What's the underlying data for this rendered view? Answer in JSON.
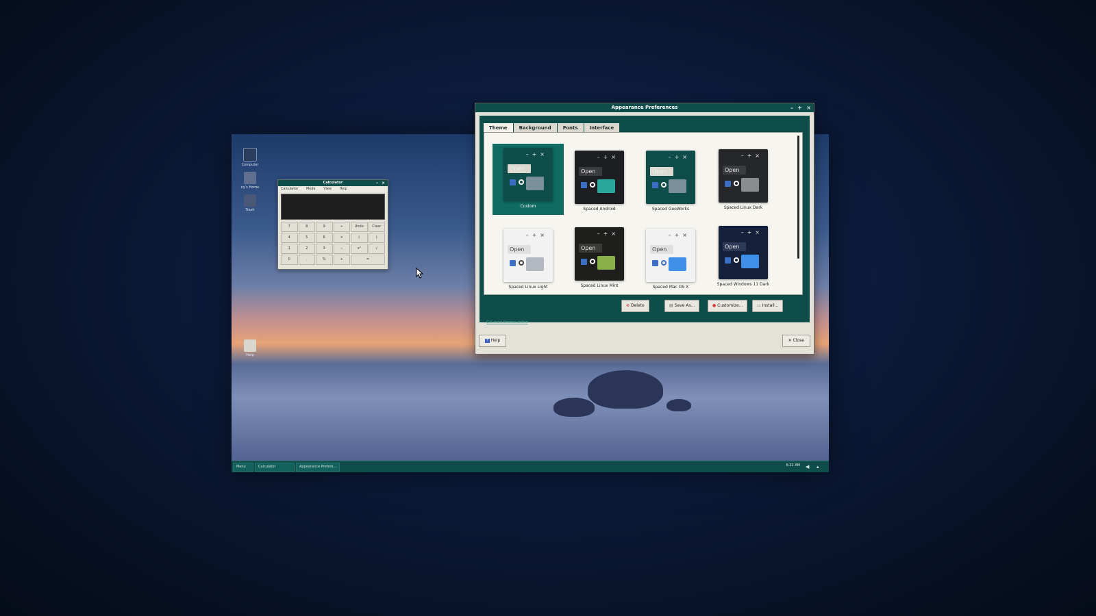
{
  "desktop": {
    "icons": [
      {
        "label": "Computer",
        "icon": "computer-icon"
      },
      {
        "label": "ny's Home",
        "icon": "home-icon"
      },
      {
        "label": "Trash",
        "icon": "trash-icon"
      },
      {
        "label": "Help",
        "icon": "help-icon"
      }
    ]
  },
  "taskbar": {
    "menu_label": "Menu",
    "tasks": [
      "Calculator",
      "Appearance Prefere..."
    ],
    "clock": "6:22 AM"
  },
  "calculator": {
    "title": "Calculator",
    "menus": [
      "Calculator",
      "Mode",
      "View",
      "Help"
    ],
    "display": "",
    "keys": [
      "7",
      "8",
      "9",
      "÷",
      "Undo",
      "Clear",
      "4",
      "5",
      "6",
      "×",
      "(",
      ")",
      "1",
      "2",
      "3",
      "−",
      "x²",
      "√",
      "0",
      ".",
      "%",
      "+",
      "="
    ]
  },
  "prefs": {
    "title": "Appearance Preferences",
    "tabs": [
      "Theme",
      "Background",
      "Fonts",
      "Interface"
    ],
    "active_tab": "Theme",
    "themes": [
      {
        "name": "Custom",
        "selected": true
      },
      {
        "name": "Spaced Android"
      },
      {
        "name": "Spaced GeoWorks"
      },
      {
        "name": "Spaced Linux Dark"
      },
      {
        "name": "Spaced Linux Light"
      },
      {
        "name": "Spaced Linux Mint"
      },
      {
        "name": "Spaced Mac OS X"
      },
      {
        "name": "Spaced Windows 11 Dark"
      }
    ],
    "preview_open_label": "Open",
    "buttons": {
      "delete": "Delete",
      "save_as": "Save As...",
      "customize": "Customize...",
      "install": "Install..."
    },
    "link": "Get more themes online",
    "help": "Help",
    "close": "Close"
  },
  "colors": {
    "titlebar": "#0f4d4a",
    "accent": "#0f6b63"
  }
}
